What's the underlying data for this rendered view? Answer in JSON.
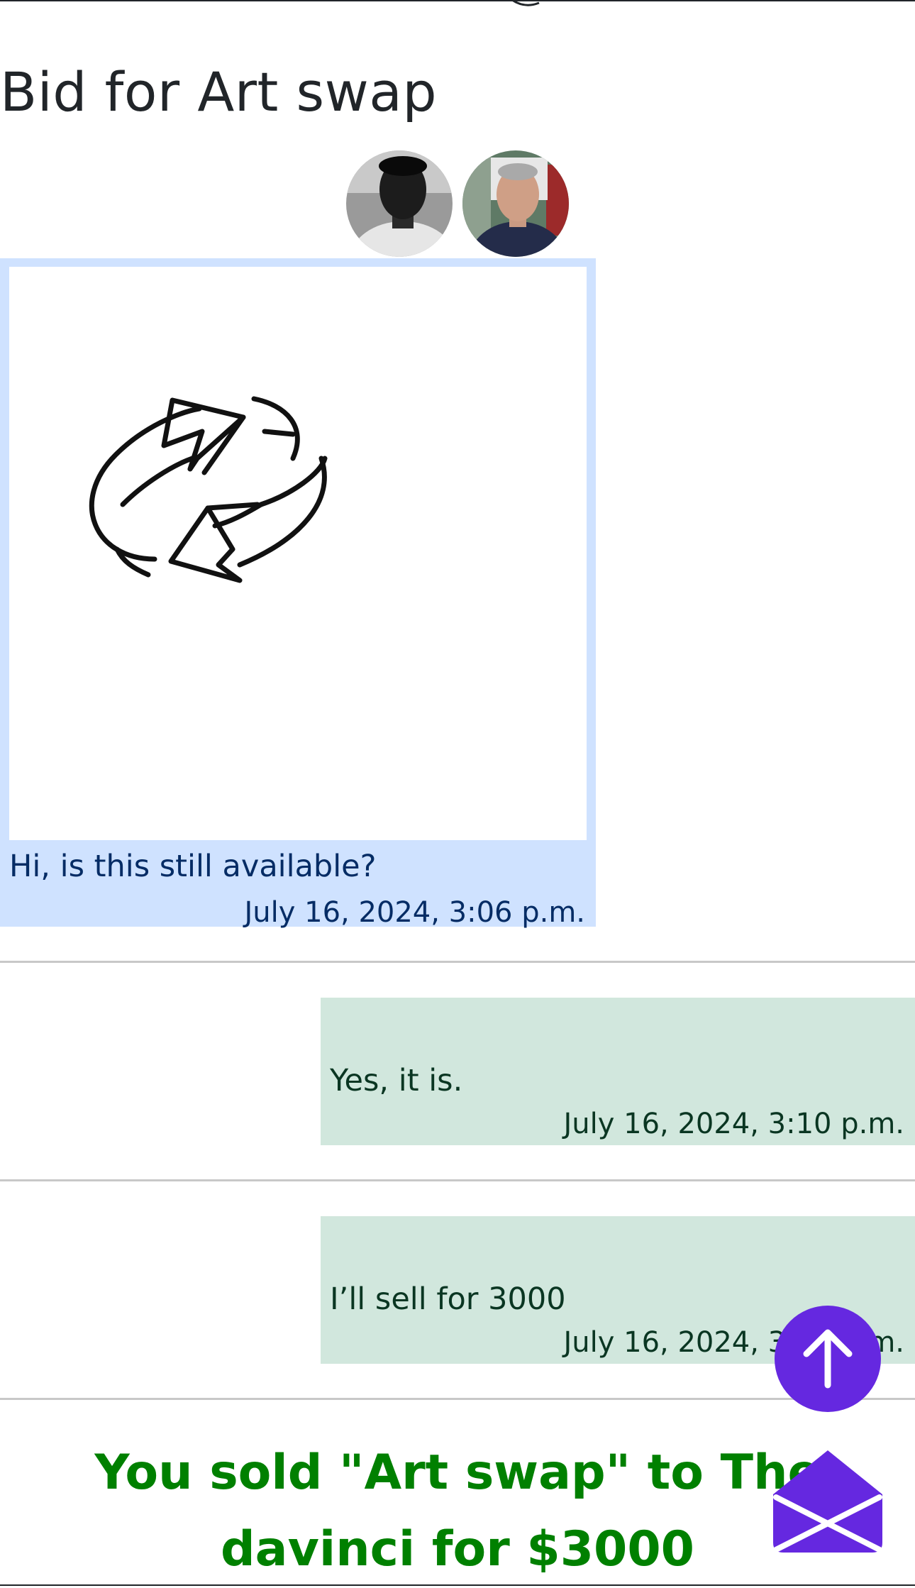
{
  "page": {
    "title": "Bid for Art swap"
  },
  "participants": [
    {
      "name": "Buyer avatar",
      "icon": "avatar-buyer"
    },
    {
      "name": "Seller avatar",
      "icon": "avatar-seller"
    }
  ],
  "messages": [
    {
      "direction": "incoming",
      "attachment_icon": "swap-arrows-icon",
      "text": "Hi, is this still available?",
      "timestamp": "July 16, 2024, 3:06 p.m."
    },
    {
      "direction": "outgoing",
      "text": "Yes, it is.",
      "timestamp": "July 16, 2024, 3:10 p.m."
    },
    {
      "direction": "outgoing",
      "text": "I’ll sell for 3000",
      "timestamp": "July 16, 2024, 3:11 p.m."
    }
  ],
  "banner": {
    "text": "You sold \"Art swap\" to The davinci for $3000"
  },
  "floating_buttons": {
    "scroll_top_icon": "arrow-up-icon",
    "mail_icon": "envelope-open-icon"
  },
  "colors": {
    "incoming_bg": "#cfe2ff",
    "outgoing_bg": "#d1e7dd",
    "banner_text": "#008000",
    "fab_bg": "#6528e0"
  }
}
